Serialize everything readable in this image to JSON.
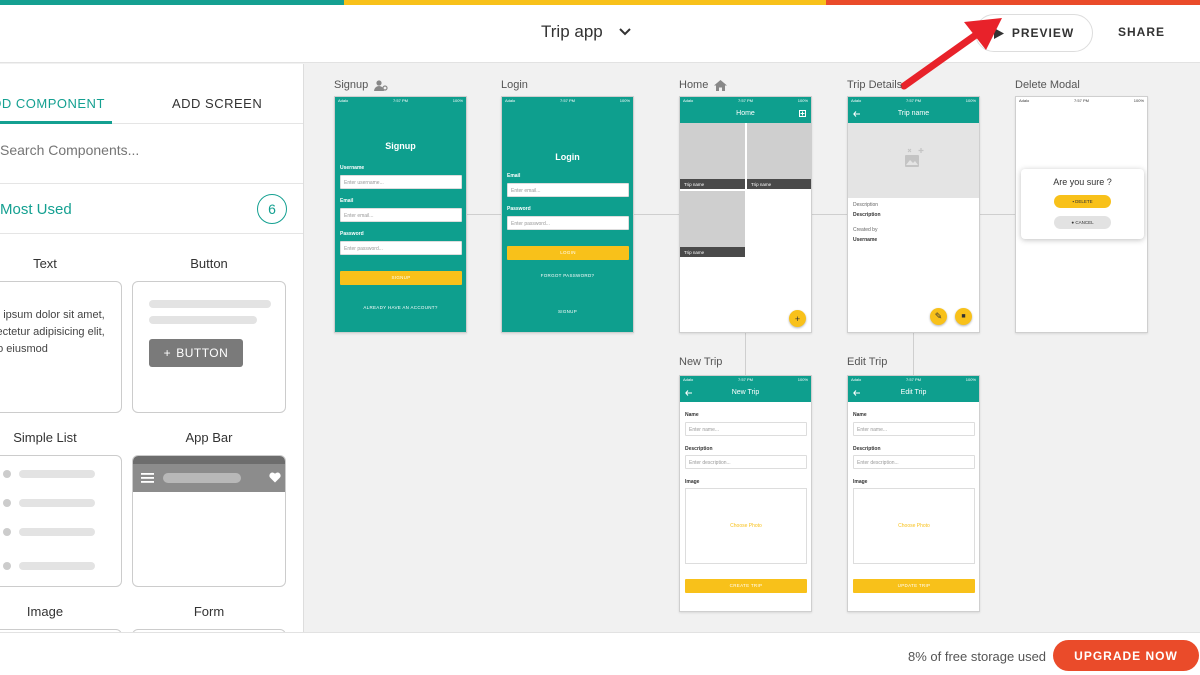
{
  "colors": {
    "accent": "#14a091",
    "brand_teal": "#0e9f8e",
    "yellow": "#f8c11a",
    "upgrade": "#ea4b2a",
    "bar_green": "#14a091",
    "bar_yellow": "#f8c11a",
    "bar_orange": "#ea4b2a"
  },
  "header": {
    "title": "Trip app",
    "preview_label": "PREVIEW",
    "share_label": "SHARE"
  },
  "sidebar": {
    "tabs": [
      {
        "label": "DD COMPONENT"
      },
      {
        "label": "ADD SCREEN"
      }
    ],
    "search_placeholder": "Search Components...",
    "most_used": {
      "label": "Most Used",
      "count": "6"
    },
    "components": [
      {
        "label": "Text",
        "preview_lines": [
          "m ipsum dolor sit amet,",
          "sectetur adipisicing elit,",
          "do eiusmod"
        ]
      },
      {
        "label": "Button",
        "button_text": "BUTTON"
      },
      {
        "label": "Simple List"
      },
      {
        "label": "App Bar"
      },
      {
        "label": "Image"
      },
      {
        "label": "Form"
      }
    ]
  },
  "screens": {
    "signup": {
      "label": "Signup",
      "title": "Signup",
      "username_label": "Username",
      "username_ph": "Enter username...",
      "email_label": "Email",
      "email_ph": "Enter email...",
      "password_label": "Password",
      "password_ph": "Enter password...",
      "button": "SIGNUP",
      "link": "ALREADY HAVE AN ACCOUNT?"
    },
    "login": {
      "label": "Login",
      "title": "Login",
      "email_label": "Email",
      "email_ph": "Enter email...",
      "password_label": "Password",
      "password_ph": "Enter password...",
      "button": "LOGIN",
      "forgot": "FORGOT PASSWORD?",
      "link": "SIGNUP"
    },
    "home": {
      "label": "Home",
      "header": "Home",
      "tile_captions": [
        "Trip name",
        "Trip name",
        "Trip name"
      ]
    },
    "trip_details": {
      "label": "Trip Details",
      "header": "Trip name",
      "desc_label": "Description",
      "desc_value": "Description",
      "created_label": "Created by",
      "created_value": "Username"
    },
    "delete_modal": {
      "label": "Delete Modal",
      "question": "Are you sure ?",
      "delete": "DELETE",
      "cancel": "CANCEL"
    },
    "new_trip": {
      "label": "New Trip",
      "header": "New Trip",
      "name_label": "Name",
      "name_ph": "Enter name...",
      "desc_label": "Description",
      "desc_ph": "Enter description...",
      "image_label": "Image",
      "choose": "Choose Photo",
      "button": "CREATE TRIP"
    },
    "edit_trip": {
      "label": "Edit Trip",
      "header": "Edit Trip",
      "name_label": "Name",
      "name_ph": "Enter name...",
      "desc_label": "Description",
      "desc_ph": "Enter description...",
      "image_label": "Image",
      "choose": "Choose Photo",
      "button": "UPDATE TRIP"
    }
  },
  "status_bar": {
    "carrier": "Adalo",
    "time": "7:57 PM",
    "battery": "100%"
  },
  "footer": {
    "storage": "8% of free storage used",
    "upgrade": "UPGRADE NOW"
  }
}
